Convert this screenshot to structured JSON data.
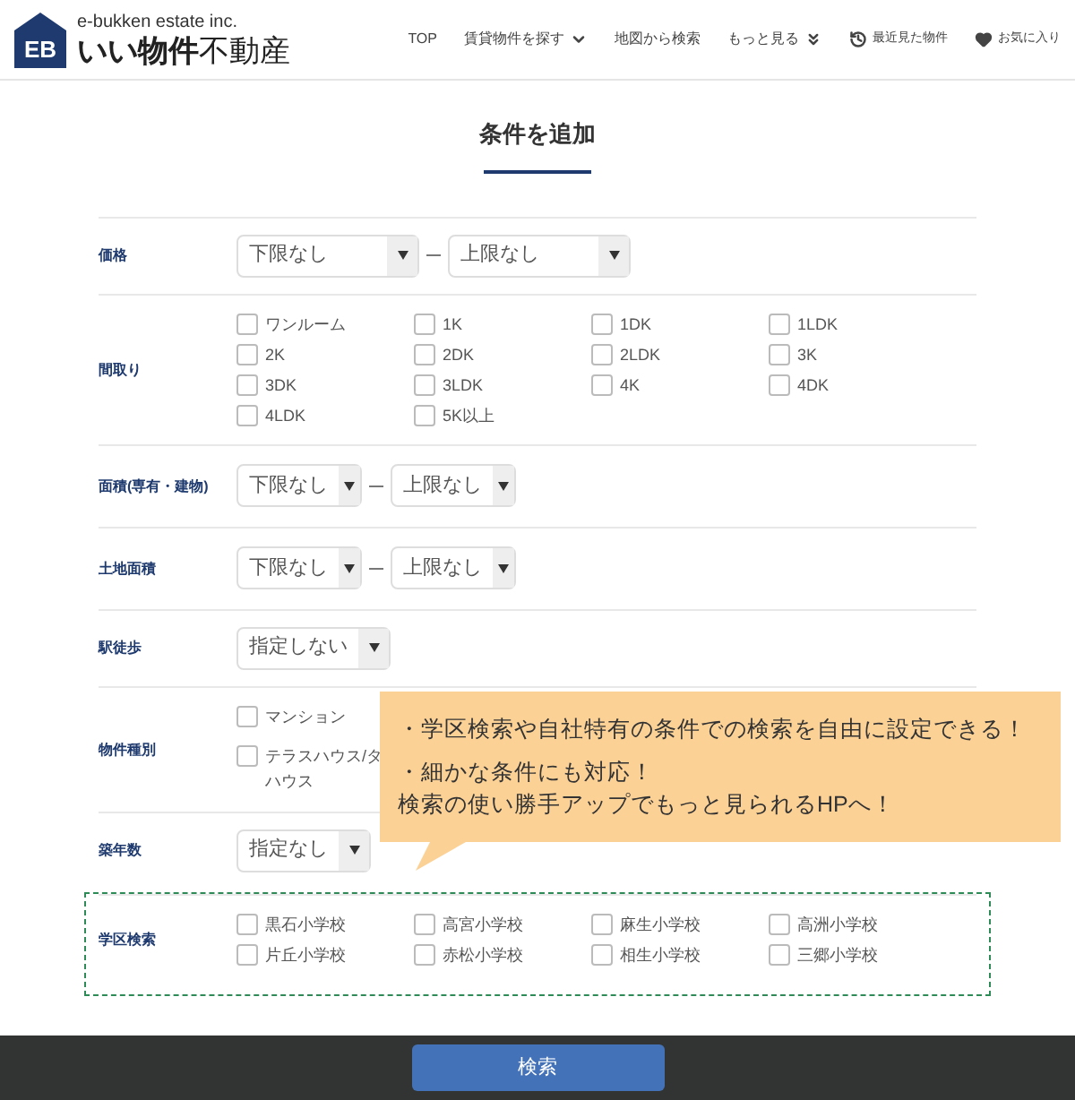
{
  "header": {
    "logo_mark": "EB",
    "company": "e-bukken estate inc.",
    "brand_bold": "いい物件",
    "brand_rest": "不動産",
    "nav": [
      {
        "label": "TOP"
      },
      {
        "label": "賃貸物件を探す"
      },
      {
        "label": "地図から検索"
      },
      {
        "label": "もっと見る"
      },
      {
        "label": "最近見た物件"
      },
      {
        "label": "お気に入り"
      }
    ]
  },
  "title": "条件を追加",
  "rows": [
    {
      "label": "価格",
      "kind": "range",
      "low": "下限なし",
      "high": "上限なし"
    },
    {
      "label": "間取り",
      "kind": "checks",
      "options": [
        {
          "label": "ワンルーム",
          "checked": false
        },
        {
          "label": "1K",
          "checked": false
        },
        {
          "label": "1DK",
          "checked": false
        },
        {
          "label": "1LDK",
          "checked": false
        },
        {
          "label": "2K",
          "checked": false
        },
        {
          "label": "2DK",
          "checked": false
        },
        {
          "label": "2LDK",
          "checked": false
        },
        {
          "label": "3K",
          "checked": false
        },
        {
          "label": "3DK",
          "checked": false
        },
        {
          "label": "3LDK",
          "checked": false
        },
        {
          "label": "4K",
          "checked": false
        },
        {
          "label": "4DK",
          "checked": false
        },
        {
          "label": "4LDK",
          "checked": false
        },
        {
          "label": "5K以上",
          "checked": false
        }
      ]
    },
    {
      "label": "面積(専有・建物)",
      "kind": "range",
      "low": "下限なし",
      "high": "上限なし"
    },
    {
      "label": "土地面積",
      "kind": "range",
      "low": "下限なし",
      "high": "上限なし"
    },
    {
      "label": "駅徒歩",
      "kind": "select",
      "value": "指定しない"
    },
    {
      "label": "物件種別",
      "kind": "types",
      "options": [
        {
          "label": "マンション",
          "checked": false
        },
        {
          "label": "テラスハウス/タ",
          "label_line2": "ハウス",
          "checked": false
        }
      ]
    },
    {
      "label": "築年数",
      "kind": "select",
      "value": "指定なし"
    },
    {
      "label": "学区検索",
      "kind": "checks",
      "highlighted": true,
      "options": [
        {
          "label": "黒石小学校",
          "checked": false
        },
        {
          "label": "高宮小学校",
          "checked": false
        },
        {
          "label": "麻生小学校",
          "checked": false
        },
        {
          "label": "高洲小学校",
          "checked": false
        },
        {
          "label": "片丘小学校",
          "checked": false
        },
        {
          "label": "赤松小学校",
          "checked": false
        },
        {
          "label": "相生小学校",
          "checked": false
        },
        {
          "label": "三郷小学校",
          "checked": false
        }
      ]
    }
  ],
  "callout": {
    "lines": [
      "・学区検索や自社特有の条件での検索を自由に設定できる！",
      "・細かな条件にも対応！",
      "検索の使い勝手アップでもっと見られるHPへ！"
    ]
  },
  "search_button": "検索"
}
